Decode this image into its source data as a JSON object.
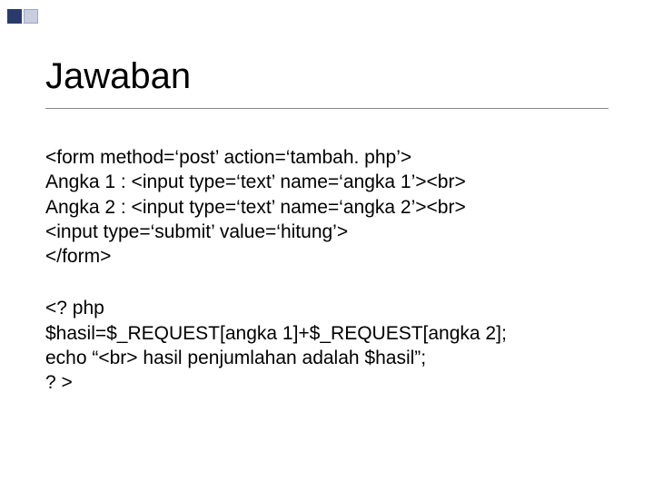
{
  "title": "Jawaban",
  "block1": {
    "l1": "<form method=‘post’ action=‘tambah. php’>",
    "l2": "Angka 1 : <input type=‘text’ name=‘angka 1’><br>",
    "l3": "Angka 2 : <input type=‘text’ name=‘angka 2’><br>",
    "l4": "<input type=‘submit’ value=‘hitung’>",
    "l5": "</form>"
  },
  "block2": {
    "l1": "<? php",
    "l2": "$hasil=$_REQUEST[angka 1]+$_REQUEST[angka 2];",
    "l3": "echo “<br> hasil penjumlahan adalah $hasil”;",
    "l4": "? >"
  }
}
